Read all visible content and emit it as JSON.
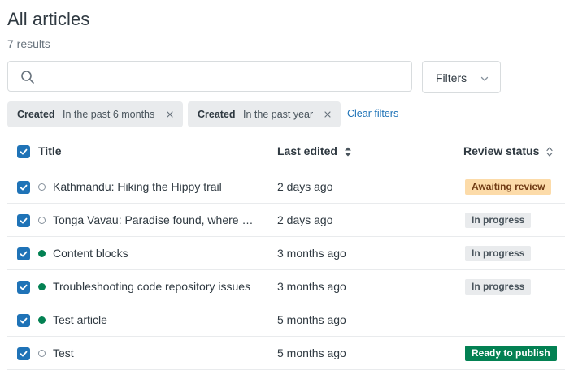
{
  "header": {
    "title": "All articles",
    "result_count": "7 results"
  },
  "search": {
    "placeholder": "",
    "value": ""
  },
  "filters_button": {
    "label": "Filters"
  },
  "active_filters": [
    {
      "key": "Created",
      "value": "In the past 6 months"
    },
    {
      "key": "Created",
      "value": "In the past year"
    }
  ],
  "clear_filters_label": "Clear filters",
  "table": {
    "columns": {
      "title": "Title",
      "last_edited": "Last edited",
      "review_status": "Review status"
    },
    "rows": [
      {
        "title": "Kathmandu: Hiking the Hippy trail",
        "published": false,
        "last_edited": "2 days ago",
        "review_status": "Awaiting review",
        "checked": true
      },
      {
        "title": "Tonga Vavau: Paradise found, where whales come to play",
        "published": false,
        "last_edited": "2 days ago",
        "review_status": "In progress",
        "checked": true
      },
      {
        "title": "Content blocks",
        "published": true,
        "last_edited": "3 months ago",
        "review_status": "In progress",
        "checked": true
      },
      {
        "title": "Troubleshooting code repository issues",
        "published": true,
        "last_edited": "3 months ago",
        "review_status": "In progress",
        "checked": true
      },
      {
        "title": "Test article",
        "published": true,
        "last_edited": "5 months ago",
        "review_status": "",
        "checked": true
      },
      {
        "title": "Test",
        "published": false,
        "last_edited": "5 months ago",
        "review_status": "Ready to publish",
        "checked": true
      }
    ]
  },
  "icons": {
    "search": "search-icon",
    "filters_chevron": "chevron-down-icon",
    "chip_remove": "close-icon",
    "checkbox": "check-icon",
    "sort_last_edited": "sort-icon",
    "sort_review_status": "sort-icon"
  },
  "colors": {
    "accent": "#1f73b7",
    "published_dot": "#038153",
    "awaiting_badge": "#fcdba9",
    "in_progress_badge": "#e9ebed",
    "ready_badge": "#038153"
  }
}
